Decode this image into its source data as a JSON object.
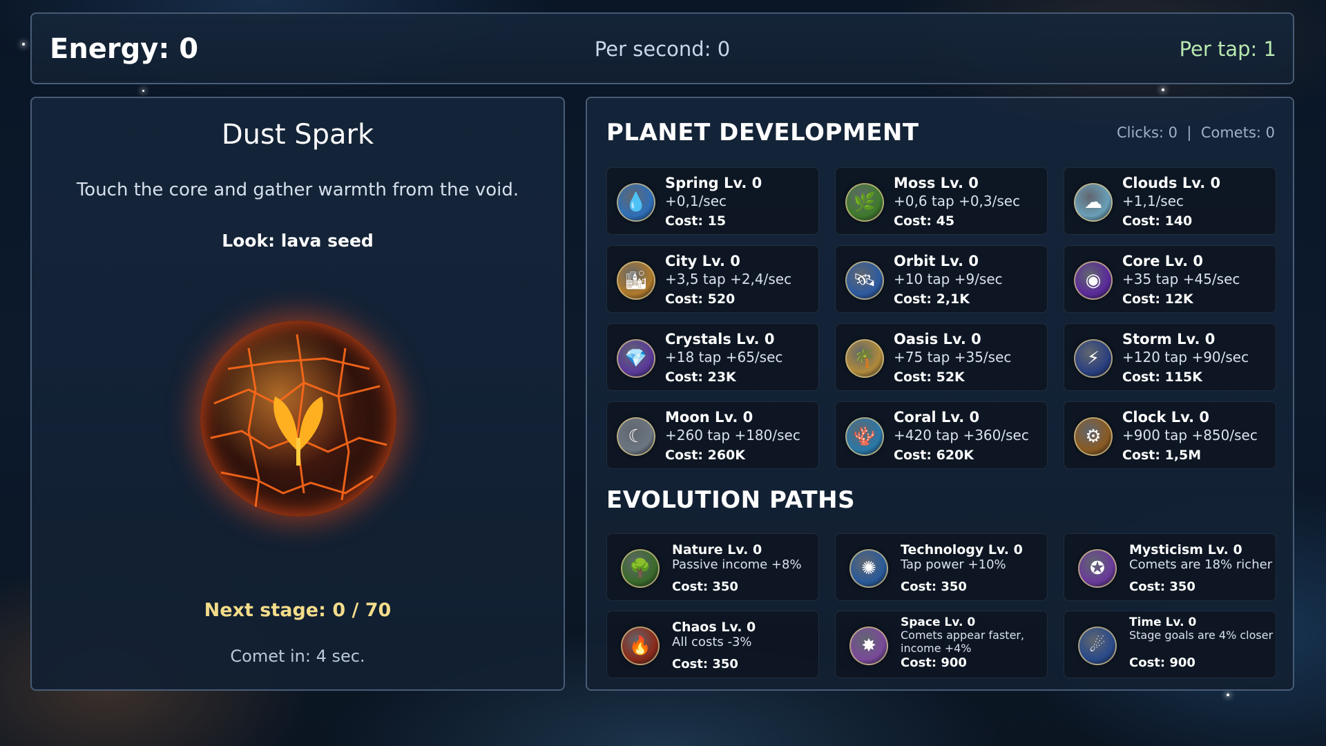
{
  "header": {
    "energy": "Energy: 0",
    "per_second": "Per second: 0",
    "per_tap": "Per tap: 1"
  },
  "planet": {
    "name": "Dust Spark",
    "description": "Touch the core and gather warmth from the void.",
    "look": "Look: lava seed",
    "next_stage": "Next stage: 0 / 70",
    "comet_in": "Comet in: 4 sec."
  },
  "development": {
    "title": "PLANET DEVELOPMENT",
    "stats": "Clicks: 0  |  Comets: 0",
    "items": [
      {
        "icon": "water-drop-icon",
        "glyph": "💧",
        "color": "#2f6fb8",
        "title": "Spring Lv. 0",
        "effect": "+0,1/sec",
        "cost": "Cost: 15"
      },
      {
        "icon": "leaf-icon",
        "glyph": "🌿",
        "color": "#3f7a2c",
        "title": "Moss Lv. 0",
        "effect": "+0,6 tap  +0,3/sec",
        "cost": "Cost: 45"
      },
      {
        "icon": "cloud-icon",
        "glyph": "☁",
        "color": "#6a9fb8",
        "title": "Clouds Lv. 0",
        "effect": "+1,1/sec",
        "cost": "Cost: 140"
      },
      {
        "icon": "city-icon",
        "glyph": "🏙",
        "color": "#b07a2a",
        "title": "City Lv. 0",
        "effect": "+3,5 tap  +2,4/sec",
        "cost": "Cost: 520"
      },
      {
        "icon": "satellite-icon",
        "glyph": "🛰",
        "color": "#2d5aa0",
        "title": "Orbit Lv. 0",
        "effect": "+10 tap  +9/sec",
        "cost": "Cost: 2,1K"
      },
      {
        "icon": "core-icon",
        "glyph": "◉",
        "color": "#5b2a9a",
        "title": "Core Lv. 0",
        "effect": "+35 tap  +45/sec",
        "cost": "Cost: 12K"
      },
      {
        "icon": "crystal-icon",
        "glyph": "💎",
        "color": "#5a3a9a",
        "title": "Crystals Lv. 0",
        "effect": "+18 tap  +65/sec",
        "cost": "Cost: 23K"
      },
      {
        "icon": "oasis-icon",
        "glyph": "🌴",
        "color": "#b08a3a",
        "title": "Oasis Lv. 0",
        "effect": "+75 tap  +35/sec",
        "cost": "Cost: 52K"
      },
      {
        "icon": "storm-icon",
        "glyph": "⚡",
        "color": "#2a3f80",
        "title": "Storm Lv. 0",
        "effect": "+120 tap  +90/sec",
        "cost": "Cost: 115K"
      },
      {
        "icon": "moon-icon",
        "glyph": "☾",
        "color": "#6c7682",
        "title": "Moon Lv. 0",
        "effect": "+260 tap  +180/sec",
        "cost": "Cost: 260K"
      },
      {
        "icon": "coral-icon",
        "glyph": "🪸",
        "color": "#2a78a8",
        "title": "Coral Lv. 0",
        "effect": "+420 tap  +360/sec",
        "cost": "Cost: 620K"
      },
      {
        "icon": "clock-gear-icon",
        "glyph": "⚙",
        "color": "#8a5a22",
        "title": "Clock Lv. 0",
        "effect": "+900 tap  +850/sec",
        "cost": "Cost: 1,5M"
      }
    ]
  },
  "evolution": {
    "title": "EVOLUTION PATHS",
    "items": [
      {
        "icon": "nature-tree-icon",
        "glyph": "🌳",
        "color": "#3a6a2a",
        "title": "Nature Lv. 0",
        "effect": "Passive income +8%",
        "cost": "Cost: 350"
      },
      {
        "icon": "technology-chip-icon",
        "glyph": "✺",
        "color": "#2a5a9a",
        "title": "Technology Lv. 0",
        "effect": "Tap power +10%",
        "cost": "Cost: 350"
      },
      {
        "icon": "mysticism-eye-icon",
        "glyph": "✪",
        "color": "#6a3a9a",
        "title": "Mysticism Lv. 0",
        "effect": "Comets are 18% richer",
        "cost": "Cost: 350"
      },
      {
        "icon": "chaos-flame-icon",
        "glyph": "🔥",
        "color": "#8a2a1a",
        "title": "Chaos Lv. 0",
        "effect": "All costs -3%",
        "cost": "Cost: 350"
      },
      {
        "icon": "space-galaxy-icon",
        "glyph": "✸",
        "color": "#7a4a9a",
        "title": "Space Lv. 0",
        "effect": "Comets appear faster, income +4%",
        "cost": "Cost: 900"
      },
      {
        "icon": "time-comet-icon",
        "glyph": "☄",
        "color": "#2a4a8a",
        "title": "Time Lv. 0",
        "effect": "Stage goals are 4% closer",
        "cost": "Cost: 900"
      }
    ]
  }
}
